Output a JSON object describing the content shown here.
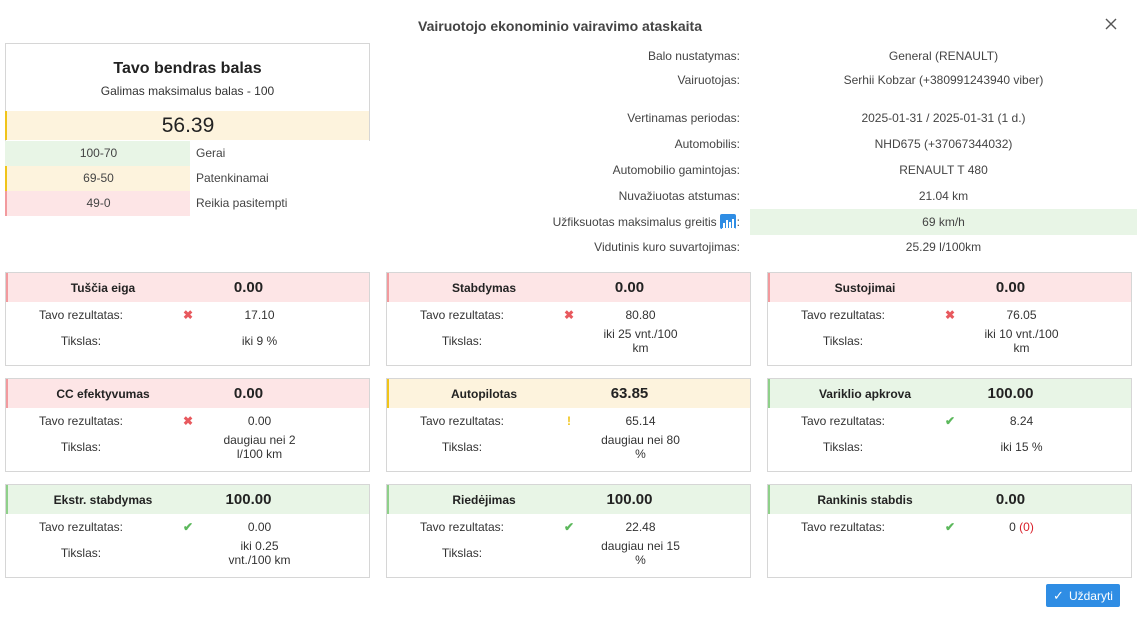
{
  "modal": {
    "title": "Vairuotojo ekonominio vairavimo ataskaita",
    "close_label": "Uždaryti"
  },
  "score": {
    "title": "Tavo bendras balas",
    "subtitle": "Galimas maksimalus balas - 100",
    "value": "56.39",
    "legend": [
      {
        "range": "100-70",
        "label": "Gerai"
      },
      {
        "range": "69-50",
        "label": "Patenkinamai"
      },
      {
        "range": "49-0",
        "label": "Reikia pasitempti"
      }
    ]
  },
  "info": [
    {
      "label": "Balo nustatymas:",
      "value": "General (RENAULT)"
    },
    {
      "label": "Vairuotojas:",
      "value": "Serhii Kobzar (+380991243940 viber)"
    },
    {
      "label": "Vertinamas periodas:",
      "value": "2025-01-31  /  2025-01-31 (1 d.)"
    },
    {
      "label": "Automobilis:",
      "value": "NHD675 (+37067344032)"
    },
    {
      "label": "Automobilio gamintojas:",
      "value": "RENAULT T 480"
    },
    {
      "label": "Nuvažiuotas atstumas:",
      "value": "21.04 km"
    },
    {
      "label": "Užfiksuotas maksimalus greitis",
      "suffix": ":",
      "value": "69 km/h"
    },
    {
      "label": "Vidutinis kuro suvartojimas:",
      "value": "25.29 l/100km"
    }
  ],
  "row_labels": {
    "result": "Tavo rezultatas:",
    "target": "Tikslas:"
  },
  "cards": [
    {
      "name": "Tuščia eiga",
      "score": "0.00",
      "result": "17.10",
      "target": "iki 9 %",
      "status": "red"
    },
    {
      "name": "Stabdymas",
      "score": "0.00",
      "result": "80.80",
      "target": "iki 25 vnt./100 km",
      "status": "red"
    },
    {
      "name": "Sustojimai",
      "score": "0.00",
      "result": "76.05",
      "target": "iki 10 vnt./100 km",
      "status": "red"
    },
    {
      "name": "CC efektyvumas",
      "score": "0.00",
      "result": "0.00",
      "target": "daugiau nei 2 l/100 km",
      "status": "red"
    },
    {
      "name": "Autopilotas",
      "score": "63.85",
      "result": "65.14",
      "target": "daugiau nei 80 %",
      "status": "yellow"
    },
    {
      "name": "Variklio apkrova",
      "score": "100.00",
      "result": "8.24",
      "target": "iki 15 %",
      "status": "green"
    },
    {
      "name": "Ekstr. stabdymas",
      "score": "100.00",
      "result": "0.00",
      "target": "iki 0.25 vnt./100 km",
      "status": "green"
    },
    {
      "name": "Riedėjimas",
      "score": "100.00",
      "result": "22.48",
      "target": "daugiau nei 15 %",
      "status": "green"
    },
    {
      "name": "Rankinis stabdis",
      "score": "0.00",
      "result": "0",
      "result_extra": "(0)",
      "status": "green"
    }
  ],
  "colors": {
    "red": "#fde5e6",
    "yellow": "#fdf3dd",
    "green": "#e8f5e6",
    "accent": "#2f8de4"
  }
}
